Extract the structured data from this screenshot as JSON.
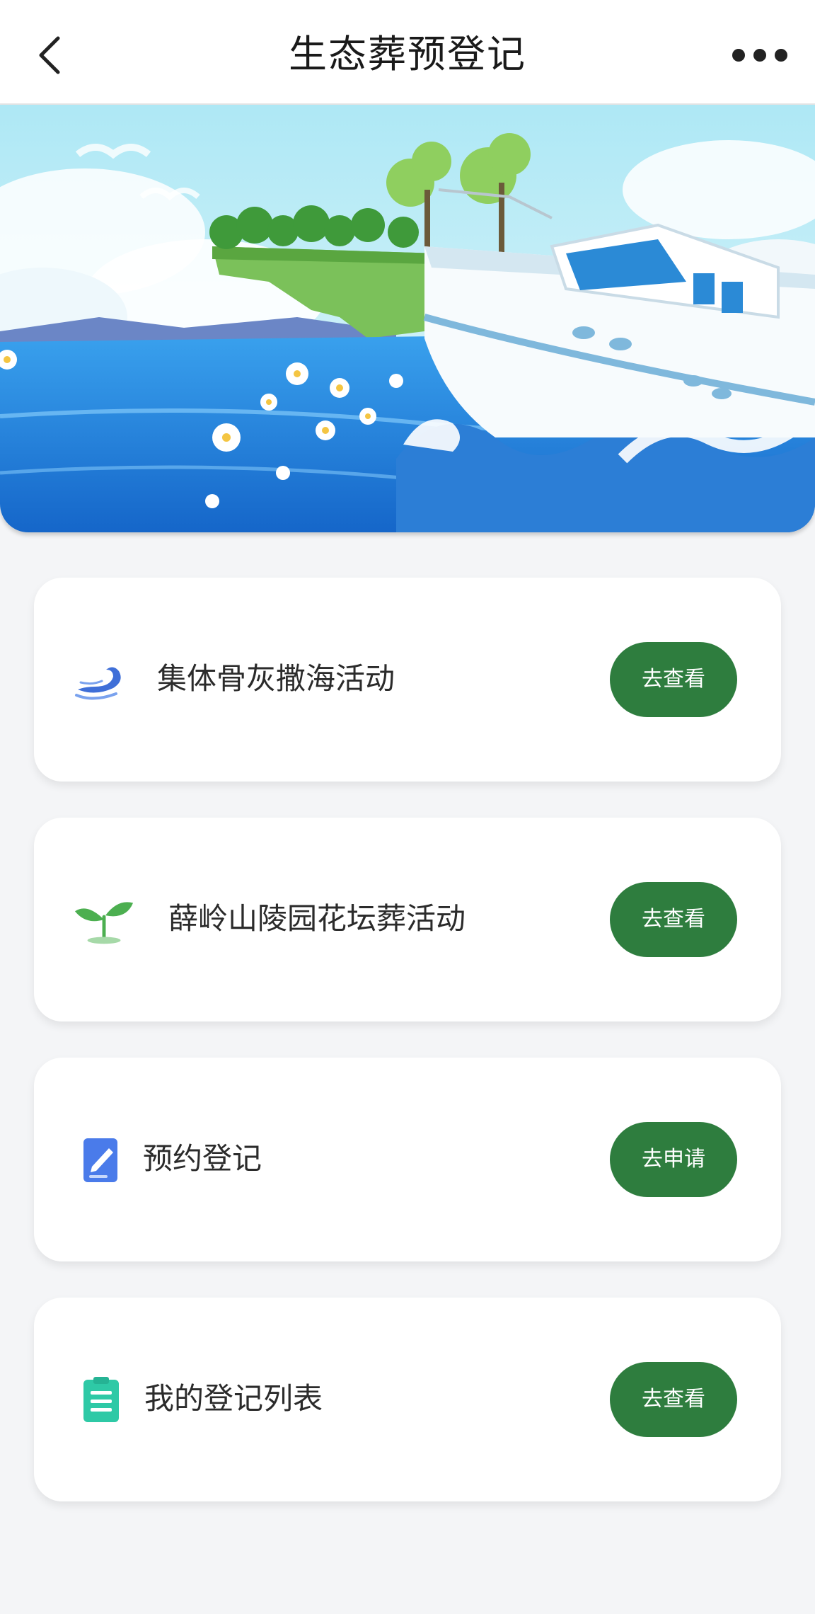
{
  "header": {
    "title": "生态葬预登记",
    "back_icon": "chevron-left-icon",
    "more_icon": "more-dots-icon"
  },
  "banner": {
    "description_icon": "sea-boat-illustration"
  },
  "cards": [
    {
      "icon": "wave-icon",
      "label": "集体骨灰撒海活动",
      "button": "去查看",
      "accent": "#3f6fd8"
    },
    {
      "icon": "sprout-icon",
      "label": "薛岭山陵园花坛葬活动",
      "button": "去查看",
      "accent": "#4caf50"
    },
    {
      "icon": "edit-document-icon",
      "label": "预约登记",
      "button": "去申请",
      "accent": "#4a7bea"
    },
    {
      "icon": "clipboard-list-icon",
      "label": "我的登记列表",
      "button": "去查看",
      "accent": "#2ec9a6"
    }
  ],
  "colors": {
    "button_bg": "#2e7d3e",
    "page_bg": "#f4f5f7"
  }
}
